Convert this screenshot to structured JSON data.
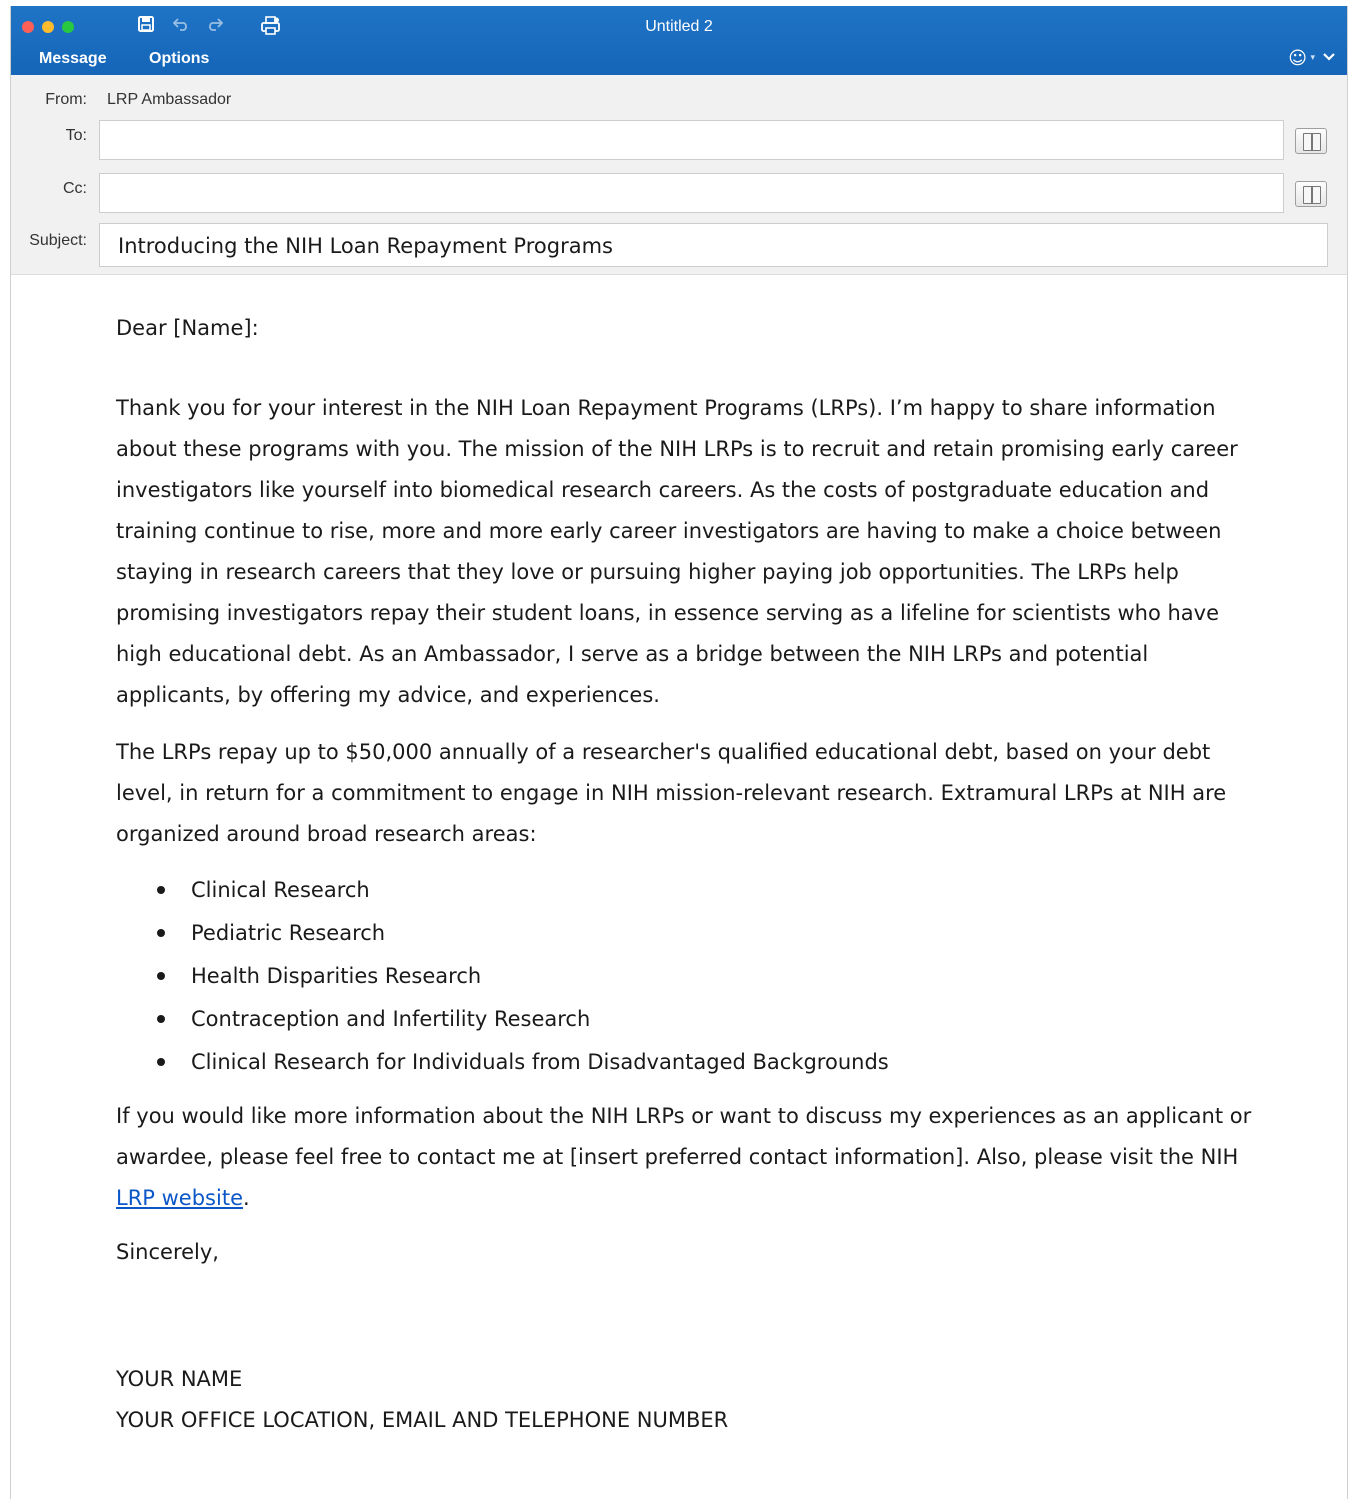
{
  "window": {
    "title": "Untitled 2"
  },
  "ribbon": {
    "tabs": [
      "Message",
      "Options"
    ]
  },
  "header": {
    "from_label": "From:",
    "from_value": "LRP Ambassador",
    "to_label": "To:",
    "to_value": "",
    "cc_label": "Cc:",
    "cc_value": "",
    "subject_label": "Subject:",
    "subject_value": "Introducing the NIH Loan Repayment Programs"
  },
  "icons": {
    "save": "save-icon",
    "undo": "undo-icon",
    "redo": "redo-icon",
    "print": "print-icon",
    "emoji": "smiley-icon",
    "collapse": "chevron-down-icon",
    "address_book": "address-book-icon"
  },
  "body": {
    "greeting": "Dear [Name]:",
    "p1": "Thank you for your interest in the NIH Loan Repayment Programs (LRPs). I’m happy to share information about these programs with you. The mission of the NIH LRPs is to recruit and retain promising early career investigators like yourself into biomedical research careers. As the costs of postgraduate education and training continue to rise, more and more early career investigators are having to make a choice between staying in research careers that they love or pursuing higher paying job opportunities. The LRPs help promising investigators repay their student loans, in essence serving as a lifeline for scientists who have high educational debt. As an Ambassador, I serve as a bridge between the NIH LRPs and potential applicants, by offering my advice, and experiences.",
    "p2": "The LRPs repay up to $50,000 annually of a researcher's qualified educational debt, based on your debt level, in return for a commitment to engage in NIH mission-relevant research. Extramural LRPs at NIH are organized around broad research areas:",
    "areas": [
      "Clinical Research",
      "Pediatric Research",
      "Health Disparities Research",
      "Contraception and Infertility Research",
      "Clinical Research for Individuals from Disadvantaged Backgrounds"
    ],
    "p3_before_link": "If you would like more information about the NIH LRPs or want to discuss my experiences as an applicant or awardee, please feel free to contact me at [insert preferred contact information]. Also, please visit the NIH ",
    "p3_link": "LRP website",
    "p3_after_link": ".",
    "closing": "Sincerely,",
    "signature_name": "YOUR NAME",
    "signature_contact": "YOUR OFFICE LOCATION, EMAIL AND TELEPHONE NUMBER"
  },
  "colors": {
    "ribbon": "#1565b8",
    "link": "#0b57c8",
    "close": "#fc5f57",
    "minimize": "#fdbc2e",
    "maximize": "#28c840"
  }
}
